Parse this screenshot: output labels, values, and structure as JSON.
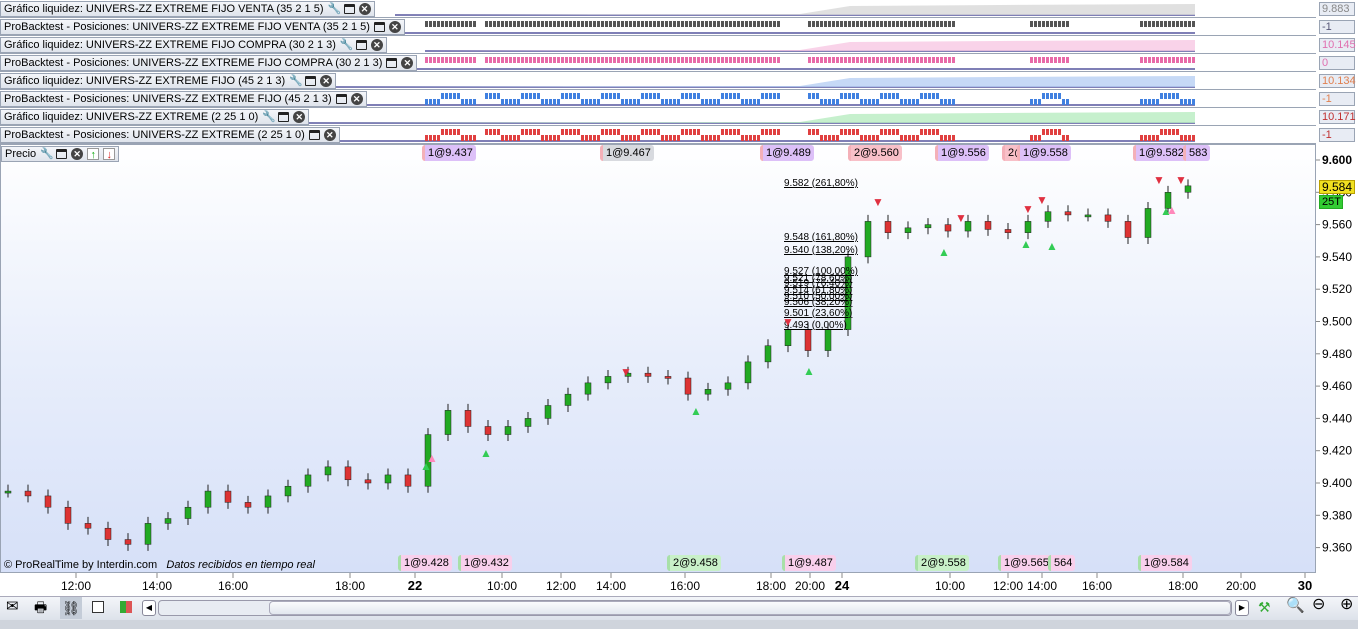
{
  "indicator_rows": [
    {
      "label": "Gráfico liquidez: UNIVERS-ZZ EXTREME FIJO VENTA (35 2 1 5)",
      "value": "9.883",
      "value_color": "#888888",
      "has_wrench": true
    },
    {
      "label": "ProBacktest - Posiciones: UNIVERS-ZZ EXTREME FIJO VENTA (35 2 1 5)",
      "value": "-1",
      "value_color": "#555577",
      "has_wrench": false
    },
    {
      "label": "Gráfico liquidez: UNIVERS-ZZ EXTREME FIJO COMPRA (30 2 1 3)",
      "value": "10.145",
      "value_color": "#e070b0",
      "has_wrench": true
    },
    {
      "label": "ProBacktest - Posiciones: UNIVERS-ZZ EXTREME FIJO COMPRA (30 2 1 3)",
      "value": "0",
      "value_color": "#e070b0",
      "has_wrench": false
    },
    {
      "label": "Gráfico liquidez: UNIVERS-ZZ EXTREME FIJO (45 2 1 3)",
      "value": "10.134",
      "value_color": "#e08050",
      "has_wrench": true
    },
    {
      "label": "ProBacktest - Posiciones: UNIVERS-ZZ EXTREME FIJO (45 2 1 3)",
      "value": "-1",
      "value_color": "#e08050",
      "has_wrench": false
    },
    {
      "label": "Gráfico liquidez: UNIVERS-ZZ EXTREME (2 25 1 0)",
      "value": "10.171",
      "value_color": "#c03030",
      "has_wrench": true
    },
    {
      "label": "ProBacktest - Posiciones: UNIVERS-ZZ EXTREME (2 25 1 0)",
      "value": "-1",
      "value_color": "#c03030",
      "has_wrench": false
    }
  ],
  "price_pane": {
    "label": "Precio",
    "current_price": "9.584",
    "volume_badge": "25T",
    "copyright": "© ProRealTime by Interdin.com",
    "status": "Datos recibidos en tiempo real"
  },
  "top_trade_labels": [
    "1@9.437",
    "1@9.467",
    "1@9.489",
    "2@9.560",
    "1@9.556",
    "2@",
    "1@9.558",
    "1@9.582",
    "583"
  ],
  "bottom_trade_labels": [
    "1@9.428",
    "1@9.432",
    "2@9.458",
    "1@9.487",
    "2@9.558",
    "1@9.565",
    "564",
    "1@9.584"
  ],
  "fib_levels": [
    "9.582 (261,80%)",
    "9.548 (161,80%)",
    "9.540 (138,20%)",
    "9.527 (100,00%)",
    "9.521 (78,60%)",
    "9.519 (76,40%)",
    "9.514 (61,80%)",
    "9.510 (50,00%)",
    "9.506 (38,20%)",
    "9.501 (23,60%)",
    "9.493 (0,00%)"
  ],
  "chart_data": {
    "type": "candlestick",
    "y_ticks": [
      "9.600",
      "9.580",
      "9.560",
      "9.540",
      "9.520",
      "9.500",
      "9.480",
      "9.460",
      "9.440",
      "9.420",
      "9.400",
      "9.380",
      "9.360"
    ],
    "ylim": [
      9.35,
      9.61
    ],
    "x_ticks": [
      "12:00",
      "14:00",
      "16:00",
      "18:00",
      "22",
      "10:00",
      "12:00",
      "14:00",
      "16:00",
      "18:00",
      "20:00",
      "24",
      "10:00",
      "12:00",
      "14:00",
      "16:00",
      "18:00",
      "20:00",
      "30"
    ],
    "closes": [
      9.395,
      9.392,
      9.385,
      9.375,
      9.372,
      9.365,
      9.362,
      9.375,
      9.378,
      9.385,
      9.395,
      9.388,
      9.385,
      9.392,
      9.398,
      9.405,
      9.41,
      9.402,
      9.4,
      9.405,
      9.398,
      9.43,
      9.445,
      9.435,
      9.43,
      9.435,
      9.44,
      9.448,
      9.455,
      9.462,
      9.466,
      9.468,
      9.466,
      9.465,
      9.455,
      9.458,
      9.462,
      9.475,
      9.485,
      9.495,
      9.482,
      9.495,
      9.54,
      9.562,
      9.555,
      9.558,
      9.56,
      9.556,
      9.562,
      9.557,
      9.555,
      9.562,
      9.568,
      9.566,
      9.566,
      9.562,
      9.552,
      9.57,
      9.58,
      9.584
    ],
    "up_color": "#22aa22",
    "down_color": "#dd3333"
  },
  "toolbar": {
    "icons": [
      "mail-icon",
      "print-icon",
      "link-icon",
      "chart-export-icon",
      "indicator-icon",
      "scroll-left-icon",
      "scroll-right-icon",
      "chart-settings-icon",
      "zoom-auto-icon",
      "zoom-out-icon",
      "zoom-in-icon"
    ]
  }
}
